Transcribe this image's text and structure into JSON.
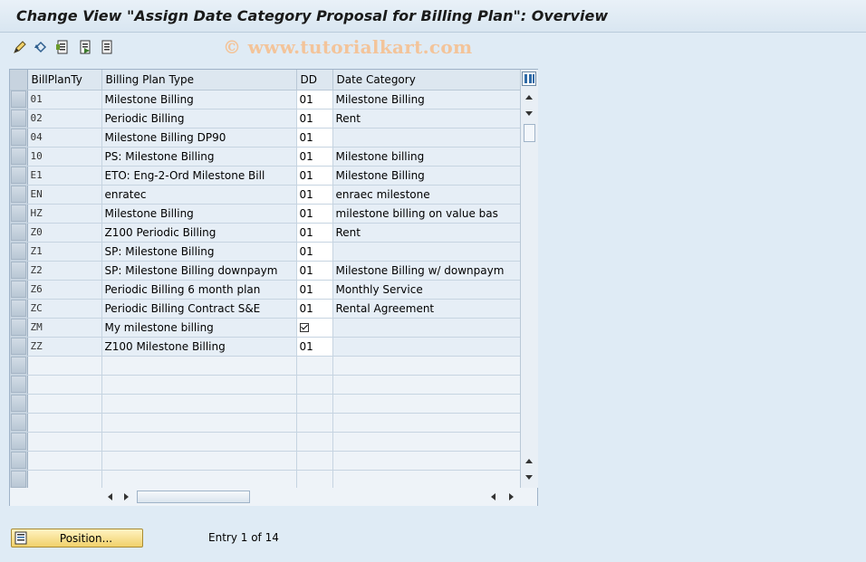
{
  "window": {
    "title": "Change View \"Assign Date Category Proposal for Billing Plan\": Overview"
  },
  "watermark": "© www.tutorialkart.com",
  "toolbar": {
    "icons": [
      "display-change-icon",
      "undo-icon",
      "details-icon",
      "next-entry-icon",
      "previous-entry-icon"
    ]
  },
  "table": {
    "columns": {
      "billplanty": "BillPlanTy",
      "billing_plan_type": "Billing Plan Type",
      "dd": "DD",
      "date_category": "Date Category"
    },
    "rows": [
      {
        "code": "01",
        "type": "Milestone Billing",
        "dd": "01",
        "category": "Milestone Billing"
      },
      {
        "code": "02",
        "type": "Periodic Billing",
        "dd": "01",
        "category": "Rent"
      },
      {
        "code": "04",
        "type": "Milestone Billing DP90",
        "dd": "01",
        "category": ""
      },
      {
        "code": "10",
        "type": "PS: Milestone Billing",
        "dd": "01",
        "category": "Milestone billing"
      },
      {
        "code": "E1",
        "type": "ETO: Eng-2-Ord Milestone Bill",
        "dd": "01",
        "category": "Milestone Billing"
      },
      {
        "code": "EN",
        "type": "enratec",
        "dd": "01",
        "category": "enraec milestone"
      },
      {
        "code": "HZ",
        "type": "Milestone Billing",
        "dd": "01",
        "category": "milestone billing on value bas"
      },
      {
        "code": "Z0",
        "type": "Z100 Periodic Billing",
        "dd": "01",
        "category": "Rent"
      },
      {
        "code": "Z1",
        "type": "SP: Milestone Billing",
        "dd": "01",
        "category": ""
      },
      {
        "code": "Z2",
        "type": "SP: Milestone Billing downpaym",
        "dd": "01",
        "category": "Milestone Billing w/ downpaym"
      },
      {
        "code": "Z6",
        "type": "Periodic Billing 6 month plan",
        "dd": "01",
        "category": "Monthly Service"
      },
      {
        "code": "ZC",
        "type": "Periodic Billing Contract S&E",
        "dd": "01",
        "category": "Rental Agreement"
      },
      {
        "code": "ZM",
        "type": "My milestone billing",
        "dd": "",
        "category": "",
        "dd_checkbox": true
      },
      {
        "code": "ZZ",
        "type": "Z100 Milestone Billing",
        "dd": "01",
        "category": ""
      }
    ],
    "empty_rows": 7
  },
  "footer": {
    "position_button": "Position...",
    "entry_info": "Entry 1 of 14"
  }
}
